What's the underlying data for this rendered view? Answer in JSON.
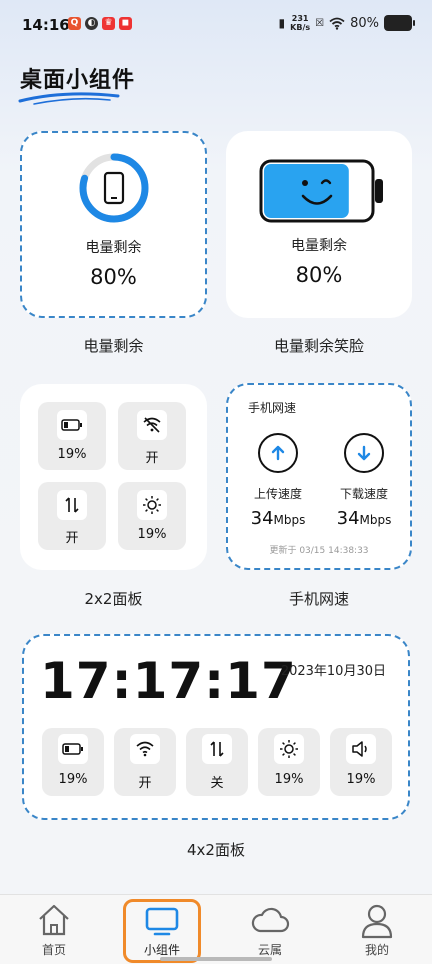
{
  "status_bar": {
    "time": "14:16",
    "net_speed_value": "231",
    "net_speed_unit": "KB/s",
    "battery_text": "80%"
  },
  "page_title": "桌面小组件",
  "widgets": {
    "battery_ring": {
      "label": "电量剩余",
      "value": "80%",
      "caption": "电量剩余",
      "level": 0.8,
      "ring_color": "#1e88e5"
    },
    "battery_smile": {
      "label": "电量剩余",
      "value": "80%",
      "caption": "电量剩余笑脸",
      "level": 0.8,
      "fill_color": "#29a3f0"
    },
    "panel_2x2": {
      "caption": "2x2面板",
      "tiles": [
        {
          "icon": "battery-icon",
          "text": "19%"
        },
        {
          "icon": "wifi-off-icon",
          "text": "开"
        },
        {
          "icon": "data-transfer-icon",
          "text": "开"
        },
        {
          "icon": "brightness-icon",
          "text": "19%"
        }
      ]
    },
    "net_speed": {
      "title": "手机网速",
      "upload_label": "上传速度",
      "upload_value": "34",
      "upload_unit": "Mbps",
      "download_label": "下载速度",
      "download_value": "34",
      "download_unit": "Mbps",
      "updated": "更新于 03/15 14:38:33",
      "caption": "手机网速",
      "upload_color": "#1e88e5",
      "download_color": "#1e88e5"
    },
    "panel_4x2": {
      "time": "17:17:17",
      "date": "2023年10月30日",
      "caption": "4x2面板",
      "tiles": [
        {
          "icon": "battery-icon",
          "text": "19%"
        },
        {
          "icon": "wifi-icon",
          "text": "开"
        },
        {
          "icon": "data-transfer-icon",
          "text": "关"
        },
        {
          "icon": "brightness-icon",
          "text": "19%"
        },
        {
          "icon": "volume-icon",
          "text": "19%"
        }
      ]
    }
  },
  "bottom_nav": {
    "items": [
      {
        "label": "首页",
        "icon": "home-icon",
        "active": false
      },
      {
        "label": "小组件",
        "icon": "monitor-icon",
        "active": true
      },
      {
        "label": "云属",
        "icon": "cloud-icon",
        "active": false
      },
      {
        "label": "我的",
        "icon": "person-icon",
        "active": false
      }
    ],
    "active_highlight_color": "#f08a2a",
    "active_icon_color": "#1e88e5"
  }
}
